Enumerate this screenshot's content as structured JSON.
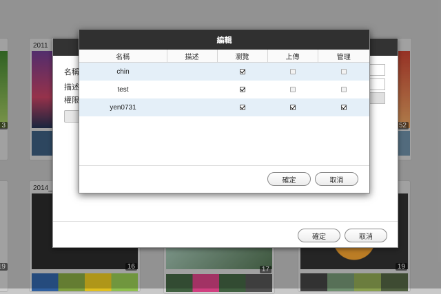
{
  "background": {
    "albums": [
      {
        "title": "2011",
        "count": "3"
      },
      {
        "title": "",
        "count": "52"
      },
      {
        "title": "2014_",
        "count": "16"
      },
      {
        "title": "",
        "count": "17"
      },
      {
        "title": "",
        "count": "19"
      },
      {
        "title": "",
        "count": "19"
      }
    ]
  },
  "back_dialog": {
    "labels": [
      "名稱",
      "描述",
      "權限"
    ],
    "ok_label": "確定",
    "cancel_label": "取消"
  },
  "front_dialog": {
    "title": "編輯",
    "columns": [
      "名稱",
      "描述",
      "瀏覽",
      "上傳",
      "管理"
    ],
    "rows": [
      {
        "name": "chin",
        "desc": "",
        "browse": true,
        "upload": false,
        "manage": false
      },
      {
        "name": "test",
        "desc": "",
        "browse": true,
        "upload": false,
        "manage": false
      },
      {
        "name": "yen0731",
        "desc": "",
        "browse": true,
        "upload": true,
        "manage": true
      }
    ],
    "ok_label": "確定",
    "cancel_label": "取消"
  },
  "colors": {
    "header": "#303030",
    "row_highlight": "#e4eff8"
  }
}
